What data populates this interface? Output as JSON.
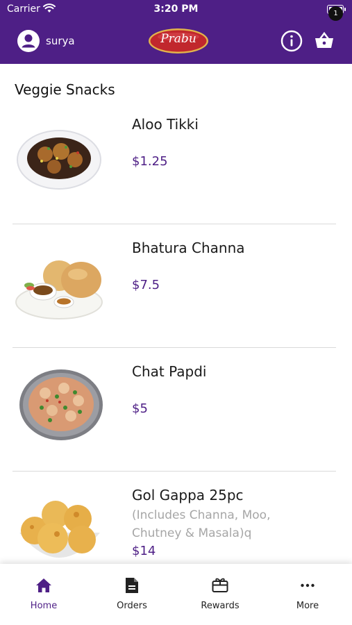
{
  "status_bar": {
    "carrier": "Carrier",
    "time": "3:20 PM"
  },
  "header": {
    "user_name": "surya",
    "logo_text": "Prabu",
    "cart_count": "1",
    "icons": {
      "user": "user-circle-icon",
      "info": "info-icon",
      "cart": "basket-icon"
    }
  },
  "section_title": "Veggie Snacks",
  "items": [
    {
      "name": "Aloo Tikki",
      "description": "",
      "price": "$1.25"
    },
    {
      "name": "Bhatura Channa",
      "description": "",
      "price": "$7.5"
    },
    {
      "name": "Chat Papdi",
      "description": "",
      "price": "$5"
    },
    {
      "name": "Gol Gappa 25pc",
      "description": "(Includes Channa, Moo, Chutney & Masala)q",
      "price": "$14"
    }
  ],
  "tabs": [
    {
      "label": "Home",
      "icon": "home-icon",
      "active": true
    },
    {
      "label": "Orders",
      "icon": "document-icon",
      "active": false
    },
    {
      "label": "Rewards",
      "icon": "gift-card-icon",
      "active": false
    },
    {
      "label": "More",
      "icon": "more-icon",
      "active": false
    }
  ],
  "colors": {
    "brand": "#4e1f86",
    "price": "#4e1f86",
    "logo_red": "#c1272d"
  }
}
